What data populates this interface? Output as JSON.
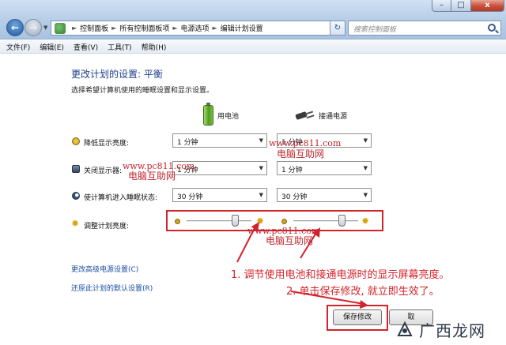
{
  "window": {
    "minimize": "–",
    "maximize": "□",
    "close": "x"
  },
  "nav": {
    "back": "←",
    "forward": "→",
    "history_dropdown": "▼"
  },
  "address": {
    "crumbs": [
      "控制面板",
      "所有控制面板项",
      "电源选项",
      "编辑计划设置"
    ],
    "separator": "►",
    "dropdown": "▼",
    "refresh": "↻"
  },
  "search": {
    "placeholder": "搜索控制面板"
  },
  "menu": [
    "文件(F)",
    "编辑(E)",
    "查看(V)",
    "工具(T)",
    "帮助(H)"
  ],
  "header": {
    "title": "更改计划的设置: 平衡",
    "subtitle": "选择希望计算机使用的睡眠设置和显示设置。"
  },
  "columns": {
    "battery": "用电池",
    "power": "接通电源"
  },
  "rows": [
    {
      "label": "降低显示亮度:",
      "battery": "1 分钟",
      "power": "1 分钟"
    },
    {
      "label": "关闭显示器:",
      "battery": "1 分钟",
      "power": "1 分钟"
    },
    {
      "label": "使计算机进入睡眠状态:",
      "battery": "30 分钟",
      "power": "30 分钟"
    }
  ],
  "select_arrow": "▼",
  "brightness": {
    "label": "调整计划亮度:",
    "battery_level": 0.78,
    "power_level": 0.78,
    "sun_glyph": "✹"
  },
  "links": {
    "advanced": "更改高级电源设置(C)",
    "restore": "还原此计划的默认设置(R)"
  },
  "buttons": {
    "save": "保存修改",
    "cancel": "取"
  },
  "annotations": {
    "note1": "1. 调节使用电池和接通电源时的显示屏幕亮度。",
    "note2": "2. 单击保存修改, 就立即生效了。"
  },
  "watermarks": {
    "url": "www.pc811.com",
    "cn": "电脑互助网"
  },
  "logo": {
    "text": "广西龙网"
  },
  "colors": {
    "accent": "#1e3f8a",
    "link": "#1b4ea5",
    "annotation": "#d3232a"
  }
}
